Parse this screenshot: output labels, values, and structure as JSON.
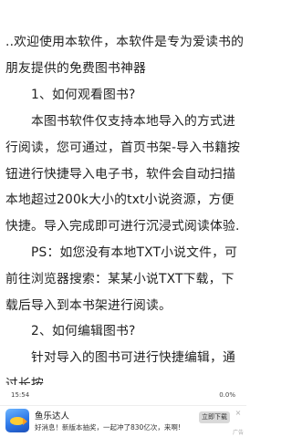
{
  "reader": {
    "paragraphs": [
      "..欢迎使用本软件，本软件是专为爱读书的朋友提供的免费图书神器",
      "1、如何观看图书?",
      "本图书软件仅支持本地导入的方式进行阅读，您可通过，首页书架-导入书籍按钮进行快捷导入电子书，软件会自动扫描本地超过200k大小的txt小说资源，方便快捷。导入完成即可进行沉浸式阅读体验.",
      "PS：如您没有本地TXT小说文件，可前往浏览器搜索：某某小说TXT下载，下载后导入到本书架进行阅读。",
      "2、如何编辑图书?",
      "针对导入的图书可进行快捷编辑，通过长按"
    ]
  },
  "status_bar": {
    "time": "15:54",
    "progress": "0.0%"
  },
  "ad": {
    "title": "鱼乐达人",
    "description": "好消息！新版本抽奖，一起冲了830亿次，来啊!",
    "button_label": "立即下载",
    "close_glyph": "×",
    "tag": "广告",
    "icon": "fish-game-icon"
  },
  "colors": {
    "text": "#222222",
    "background": "#ffffff"
  }
}
